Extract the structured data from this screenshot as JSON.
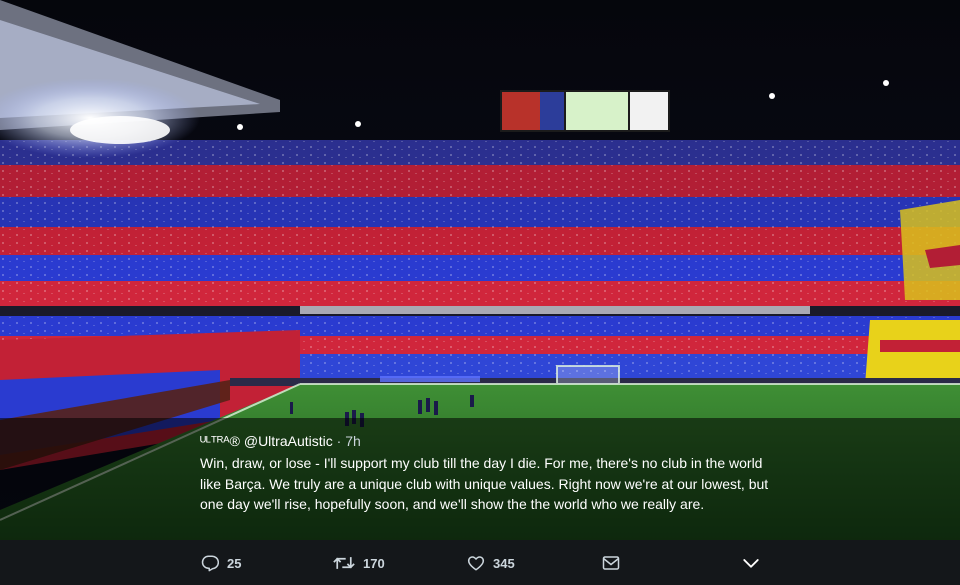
{
  "tweet": {
    "display_name": "ᵁᴸᵀᴿᴬ®",
    "handle": "@UltraAutistic",
    "separator": "·",
    "time": "7h",
    "text": "Win, draw, or lose - I'll support my club till the day I die. For me, there's no club in the world like Barça. We truly are a unique club with unique values. Right now we're at our lowest, but one day we'll rise, hopefully soon, and we'll show the the world who we really are."
  },
  "actions": {
    "reply_count": "25",
    "retweet_count": "170",
    "like_count": "345"
  },
  "icons": {
    "reply": "reply-icon",
    "retweet": "retweet-icon",
    "like": "heart-icon",
    "message": "envelope-icon",
    "more": "chevron-down-icon"
  },
  "colors": {
    "blaugrana_blue": "#2a3bd0",
    "blaugrana_red": "#d0263c",
    "senyera_yellow": "#e8d21a",
    "pitch_green": "#2f7a2a",
    "action_bar": "#14171a"
  }
}
